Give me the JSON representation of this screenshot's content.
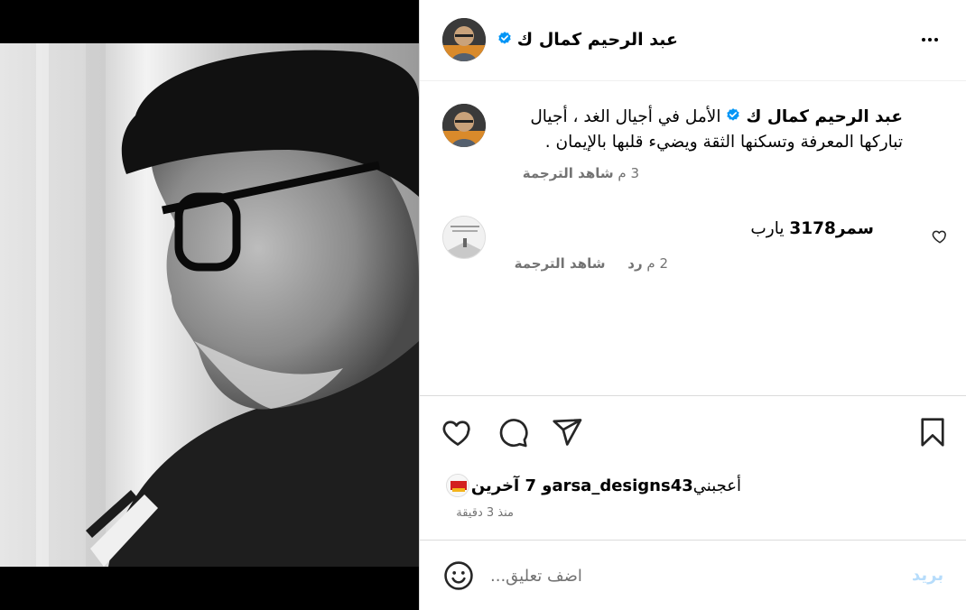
{
  "post": {
    "author": "عبد الرحيم كمال ك",
    "verified_color": "#0095f6",
    "more_icon": "more-horizontal-icon"
  },
  "caption": {
    "username": "عبد الرحيم كمال ك",
    "line1": "الأمل في أجيال الغد ، أجيال",
    "line2": "تباركها المعرفة وتسكنها الثقة ويضيء قلبها بالإيمان .",
    "see_translation": "شاهد الترجمة",
    "age": "3 م"
  },
  "comments": [
    {
      "username": "سمر3178",
      "text": "يارب",
      "see_translation": "شاهد الترجمة",
      "reply": "رد",
      "age": "2 م"
    }
  ],
  "actions": {
    "like_icon": "heart-icon",
    "comment_icon": "comment-icon",
    "share_icon": "send-icon",
    "save_icon": "bookmark-icon"
  },
  "likes": {
    "prefix": "أعجبني",
    "user": "arsa_designs43",
    "suffix": "و 7 آخرين"
  },
  "timestamp": "منذ 3 دقيقة",
  "comment_box": {
    "placeholder": "اضف تعليق...",
    "post_label": "بريد",
    "post_color": "#b6dcfb"
  }
}
